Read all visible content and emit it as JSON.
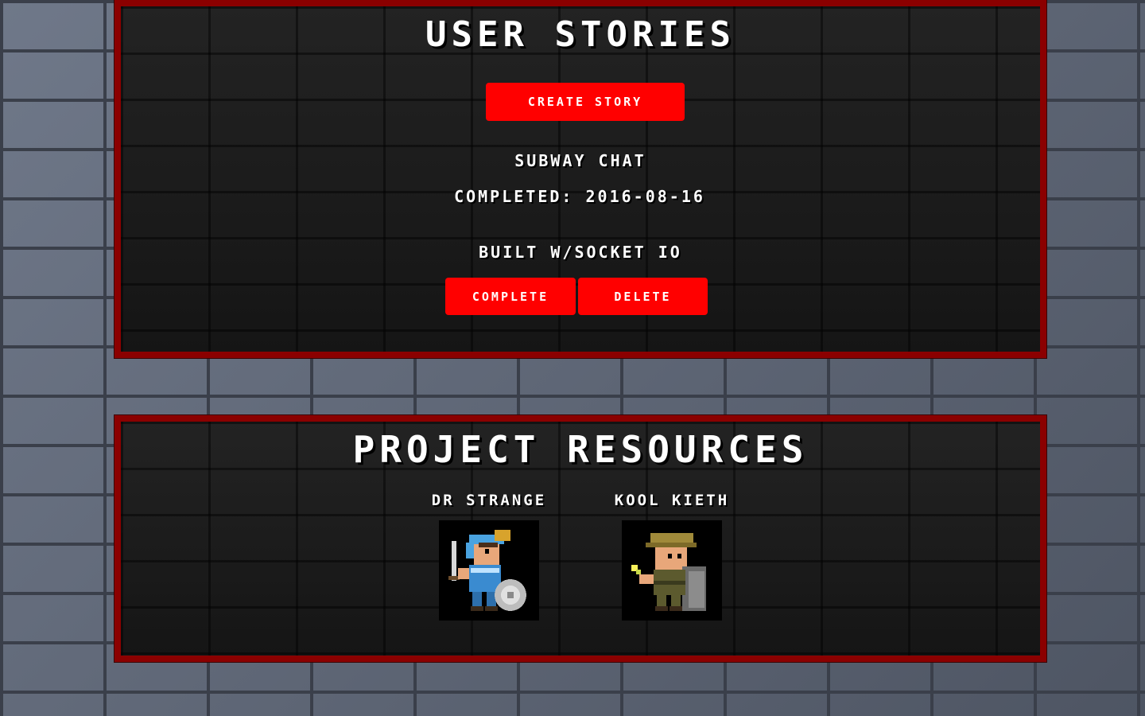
{
  "stories_section": {
    "title": "USER STORIES",
    "create_button": "CREATE STORY",
    "story": {
      "name": "SUBWAY CHAT",
      "completed": "COMPLETED: 2016-08-16",
      "built": "BUILT W/SOCKET IO",
      "complete_button": "COMPLETE",
      "delete_button": "DELETE"
    }
  },
  "resources_section": {
    "title": "PROJECT RESOURCES",
    "resources": [
      {
        "name": "DR STRANGE",
        "icon": "knight-avatar-icon"
      },
      {
        "name": "KOOL KIETH",
        "icon": "ranger-avatar-icon"
      }
    ]
  },
  "colors": {
    "accent": "#ff0000",
    "panel_border": "#8b0000",
    "panel_bg": "#1a1a1a",
    "wall": "#5a6272"
  }
}
